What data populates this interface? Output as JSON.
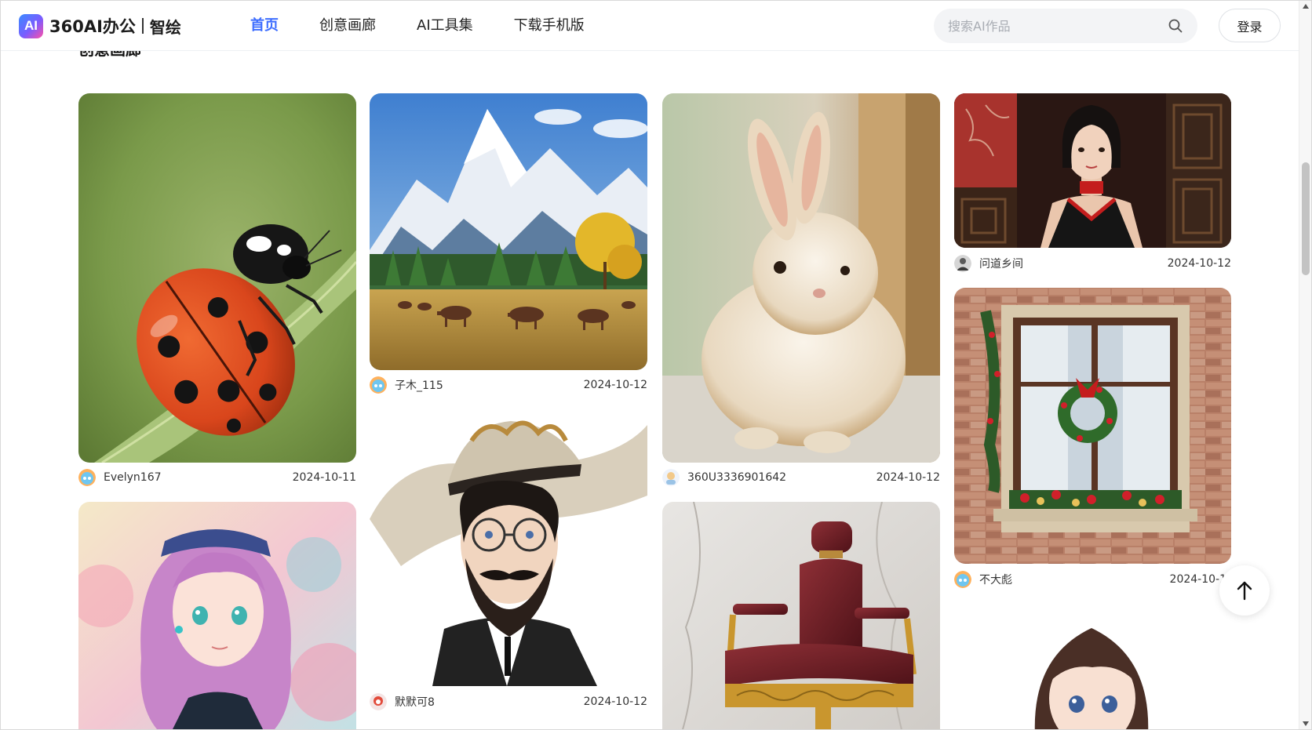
{
  "header": {
    "logo_badge": "AI",
    "logo_text": "360AI办公",
    "logo_sub": "智绘",
    "nav": [
      {
        "label": "首页",
        "active": true
      },
      {
        "label": "创意画廊",
        "active": false
      },
      {
        "label": "AI工具集",
        "active": false
      },
      {
        "label": "下载手机版",
        "active": false
      }
    ],
    "search_placeholder": "搜索AI作品",
    "login_label": "登录",
    "accent_color": "#3d6dff"
  },
  "section": {
    "title": "创意画廊"
  },
  "gallery": {
    "cards": [
      {
        "subject": "ladybug",
        "author": "Evelyn167",
        "date": "2024-10-11"
      },
      {
        "subject": "mountain-horses",
        "author": "子木_115",
        "date": "2024-10-12"
      },
      {
        "subject": "rabbit",
        "author": "360U3336901642",
        "date": "2024-10-12"
      },
      {
        "subject": "qipao-woman",
        "author": "问道乡间",
        "date": "2024-10-12"
      },
      {
        "subject": "christmas-window",
        "author": "不大彪",
        "date": "2024-10-1"
      },
      {
        "subject": "bearded-man-hat",
        "author": "默默可8",
        "date": "2024-10-12"
      },
      {
        "subject": "anime-girl-pink-hair",
        "author": "",
        "date": ""
      },
      {
        "subject": "barber-chair",
        "author": "",
        "date": ""
      },
      {
        "subject": "anime-girl-brown-hair",
        "author": "",
        "date": ""
      }
    ]
  },
  "back_to_top": {
    "icon": "arrow-up-icon"
  }
}
